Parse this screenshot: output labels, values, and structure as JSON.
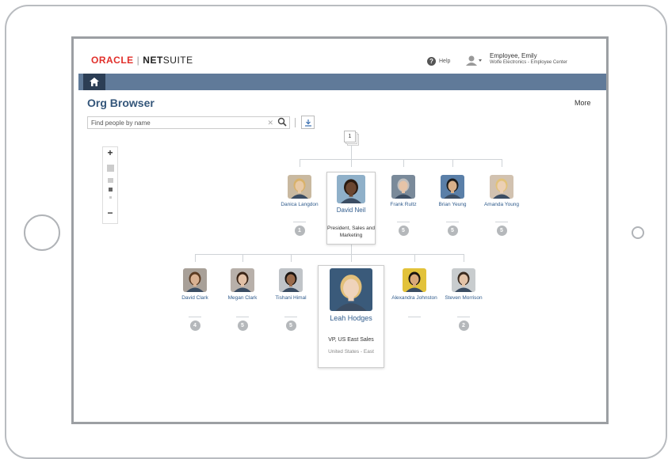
{
  "brand": {
    "oracle": "ORACLE",
    "sep": "|",
    "net": "NET",
    "suite": "SUITE"
  },
  "header": {
    "help_label": "Help",
    "user_name": "Employee, Emily",
    "user_context": "Wolfe Electronics - Employee Center"
  },
  "page": {
    "title": "Org Browser",
    "more_label": "More",
    "search_placeholder": "Find people by name"
  },
  "org": {
    "top_count": "1",
    "level1": [
      {
        "name": "Danica Langdon",
        "badge": "1",
        "skin": "#e8c9a5",
        "hair": "#d9b26a",
        "bg": "#c9b9a0"
      },
      {
        "name": "David Neil",
        "title": "President, Sales and Marketing",
        "skin": "#6b4630",
        "hair": "#2a1a10",
        "bg": "#8fb0c9"
      },
      {
        "name": "Frank Rultz",
        "badge": "5",
        "skin": "#e6c4a8",
        "hair": "#bfbfbf",
        "bg": "#7a8a9a"
      },
      {
        "name": "Brian Yeung",
        "badge": "5",
        "skin": "#d8b08a",
        "hair": "#1c1c1c",
        "bg": "#5a7fa8"
      },
      {
        "name": "Amanda Young",
        "badge": "5",
        "skin": "#ecd0b4",
        "hair": "#e2c27a",
        "bg": "#d2c2b0"
      }
    ],
    "level2": [
      {
        "name": "David Clark",
        "badge": "4",
        "skin": "#d9b192",
        "hair": "#5a3a22",
        "bg": "#a8a098"
      },
      {
        "name": "Megan Clark",
        "badge": "5",
        "skin": "#e2c0a6",
        "hair": "#3a2416",
        "bg": "#b8b0aa"
      },
      {
        "name": "Tishani Himal",
        "badge": "5",
        "skin": "#9a6b4c",
        "hair": "#1a1410",
        "bg": "#c0c4c8"
      },
      {
        "name": "Leah Hodges",
        "title": "VP, US East Sales",
        "location": "United States - East",
        "skin": "#efd3bb",
        "hair": "#e3c07a",
        "bg": "#3a5a7a"
      },
      {
        "name": "Alexandra Johnston",
        "skin": "#d9a87a",
        "hair": "#1a1410",
        "bg": "#e2c23a"
      },
      {
        "name": "Steven Morrison",
        "badge": "2",
        "skin": "#e3c3a8",
        "hair": "#3a2a1e",
        "bg": "#c8ccce"
      }
    ]
  },
  "colors": {
    "navbar": "#607a99",
    "home_tab": "#2c3e55",
    "title": "#34567a",
    "oracle_red": "#e12f2a"
  },
  "icons": [
    "home-icon",
    "help-icon",
    "user-icon",
    "search-icon",
    "clear-icon",
    "export-icon",
    "zoom-in-icon",
    "zoom-out-icon"
  ]
}
